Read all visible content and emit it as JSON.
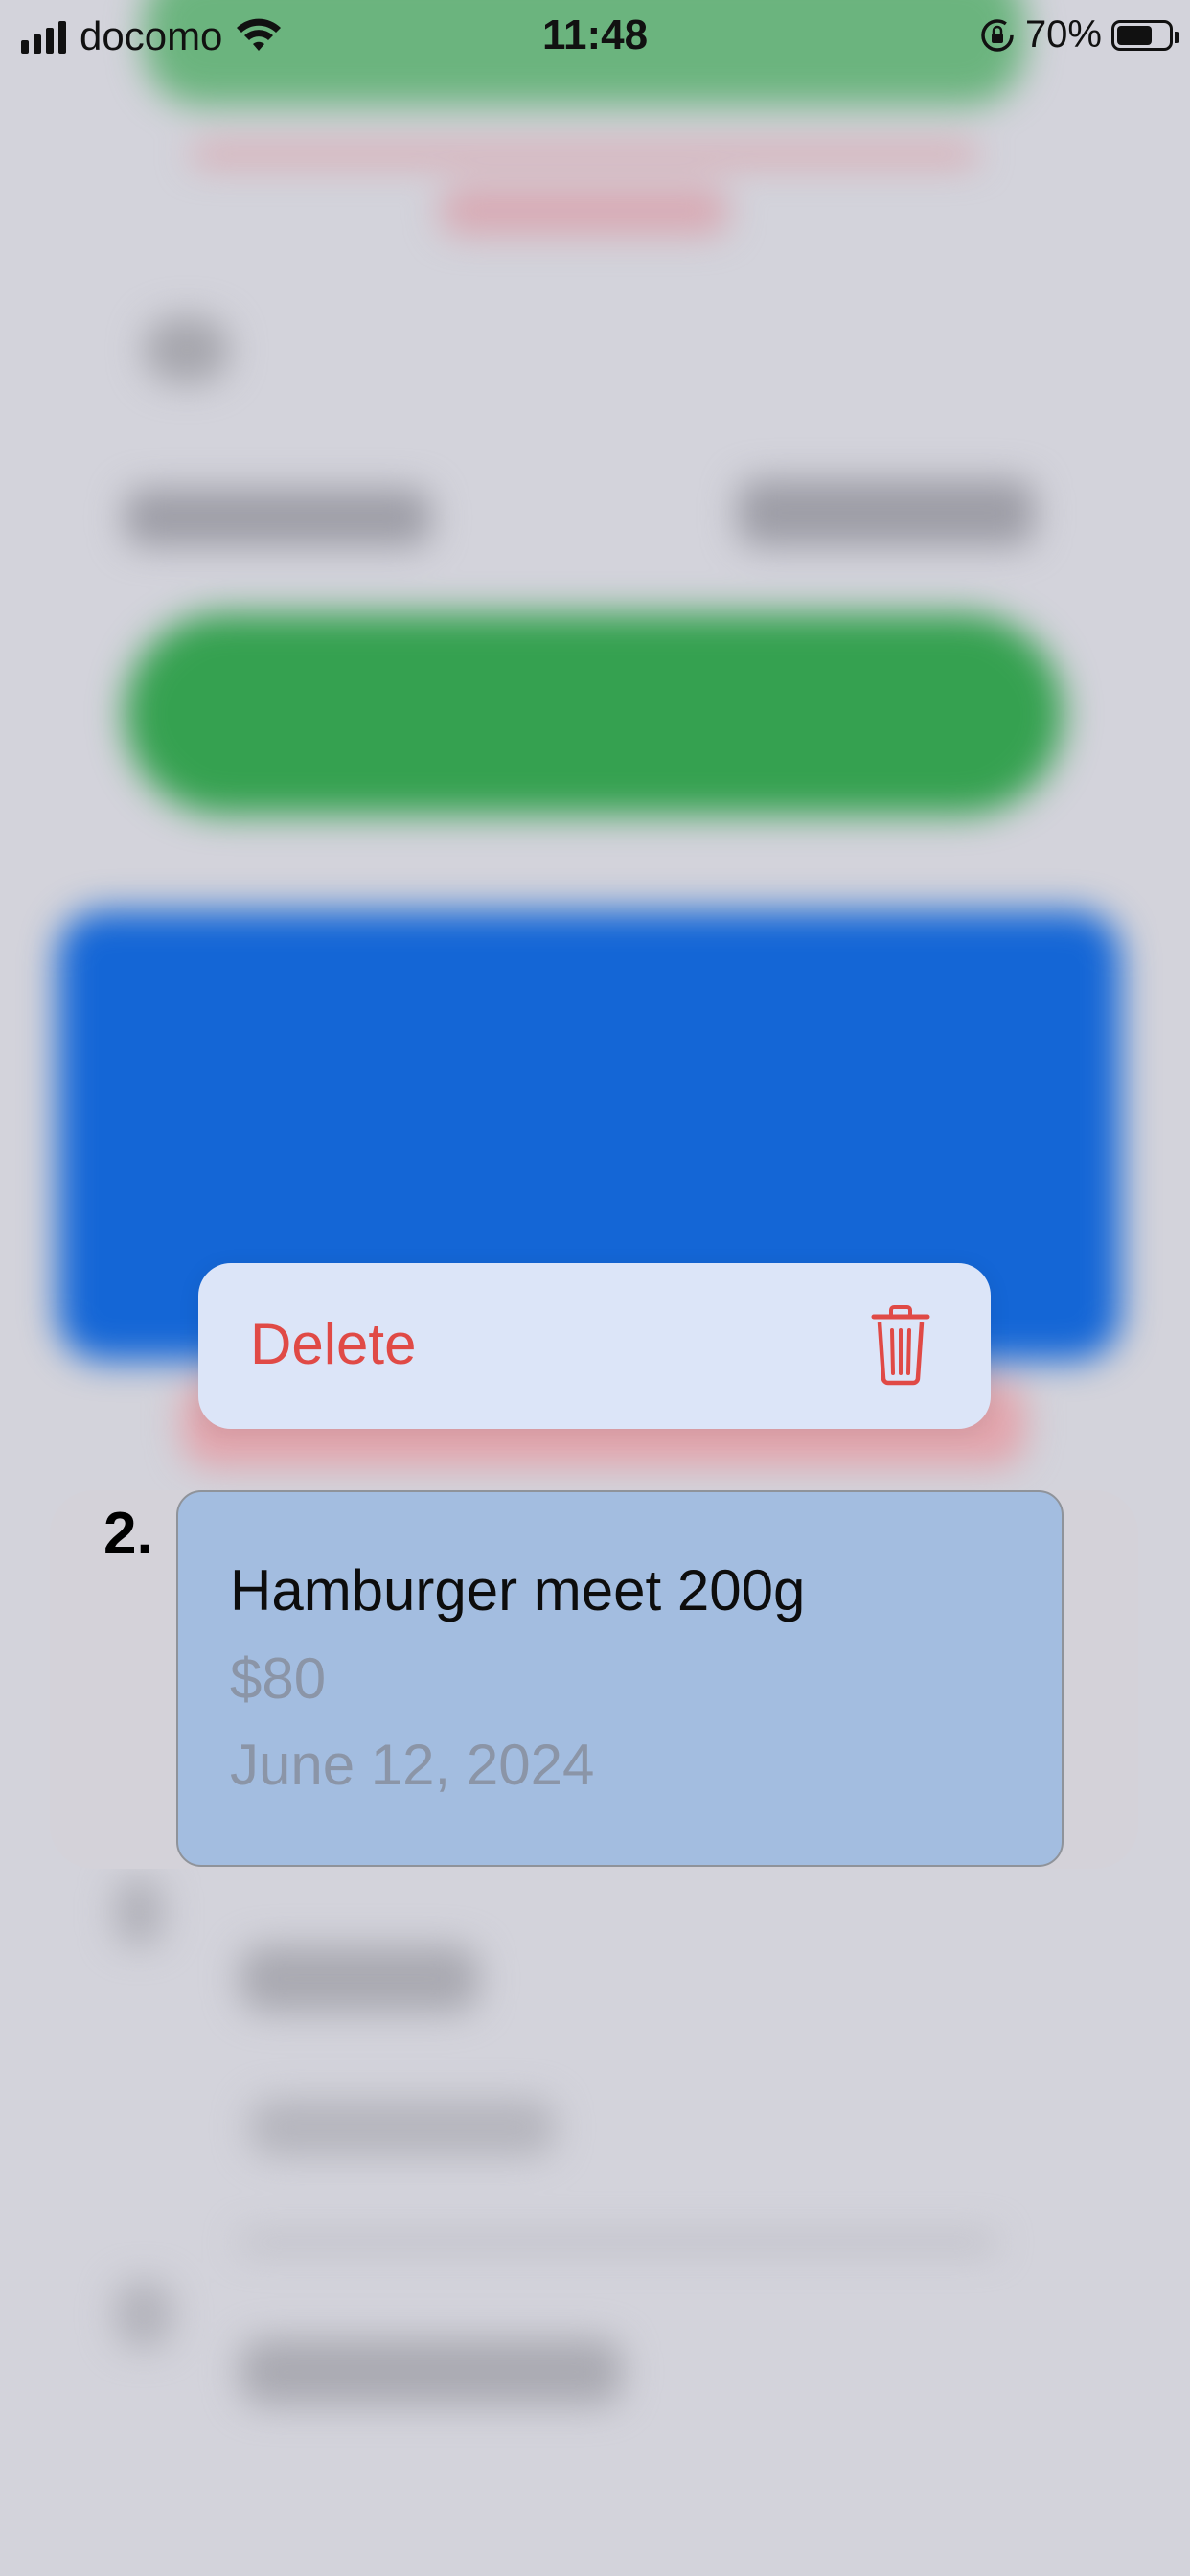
{
  "status_bar": {
    "carrier": "docomo",
    "time": "11:48",
    "battery_percent": "70%",
    "battery_level": 0.7
  },
  "context_menu": {
    "delete_label": "Delete",
    "delete_icon": "trash-icon",
    "accent_color": "#e04a46"
  },
  "selected_item": {
    "index": "2.",
    "name": "Hamburger meet 200g",
    "price": "$80",
    "date": "June 12, 2024"
  }
}
